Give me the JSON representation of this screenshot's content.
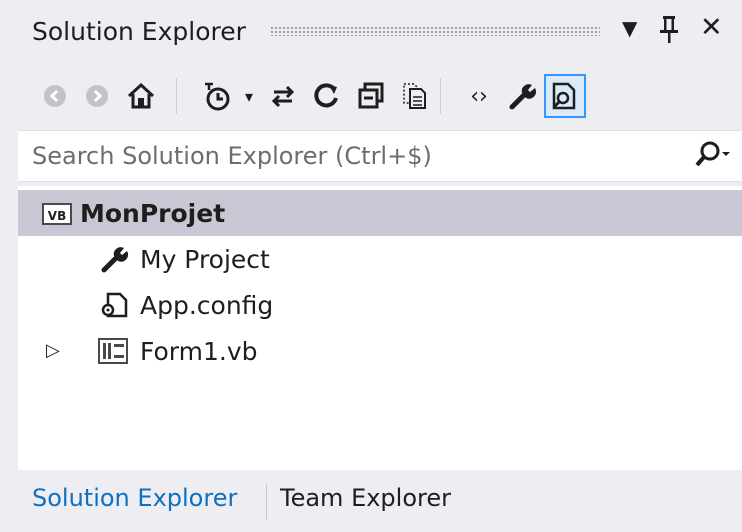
{
  "window": {
    "title": "Solution Explorer",
    "dropdown_glyph": "▼",
    "pin_glyph": "Ꝑ",
    "close_glyph": "✕"
  },
  "toolbar": {
    "buttons": [
      {
        "name": "back",
        "icon": "back-icon",
        "glyph": "◉",
        "enabled": false
      },
      {
        "name": "forward",
        "icon": "forward-icon",
        "glyph": "◉",
        "enabled": false
      },
      {
        "name": "home",
        "icon": "home-icon",
        "glyph": "⌂",
        "enabled": true
      },
      {
        "name": "pending-changes-filter",
        "icon": "clock-filter-icon",
        "glyph": "◷",
        "enabled": true
      },
      {
        "name": "dropdown",
        "icon": "chevron-down-icon",
        "glyph": "▾",
        "enabled": true
      },
      {
        "name": "sync-with-active-document",
        "icon": "sync-icon",
        "glyph": "⇄",
        "enabled": true
      },
      {
        "name": "refresh",
        "icon": "refresh-icon",
        "glyph": "↻",
        "enabled": true
      },
      {
        "name": "collapse-all",
        "icon": "collapse-all-icon",
        "glyph": "⊟",
        "enabled": true
      },
      {
        "name": "show-all-files",
        "icon": "show-all-files-icon",
        "glyph": "❐",
        "enabled": true
      },
      {
        "name": "view-code",
        "icon": "code-icon",
        "glyph": "‹›",
        "enabled": true
      },
      {
        "name": "properties",
        "icon": "wrench-icon",
        "glyph": "🔧",
        "enabled": true
      },
      {
        "name": "preview-selected-items",
        "icon": "preview-icon",
        "glyph": "⎘",
        "enabled": true
      }
    ]
  },
  "search": {
    "placeholder": "Search Solution Explorer (Ctrl+$)",
    "icon_glyph": "⚲",
    "dropdown_glyph": "▾"
  },
  "tree": {
    "project": {
      "label": "MonProjet",
      "icon": "vb-project-icon",
      "icon_text": "VB"
    },
    "items": [
      {
        "label": "My Project",
        "icon": "wrench-icon",
        "glyph": "🔧"
      },
      {
        "label": "App.config",
        "icon": "config-file-icon",
        "glyph": "⎘"
      },
      {
        "label": "Form1.vb",
        "icon": "form-icon",
        "expander": "▷"
      }
    ]
  },
  "tabs": [
    {
      "label": "Solution Explorer",
      "active": true
    },
    {
      "label": "Team Explorer",
      "active": false
    }
  ]
}
